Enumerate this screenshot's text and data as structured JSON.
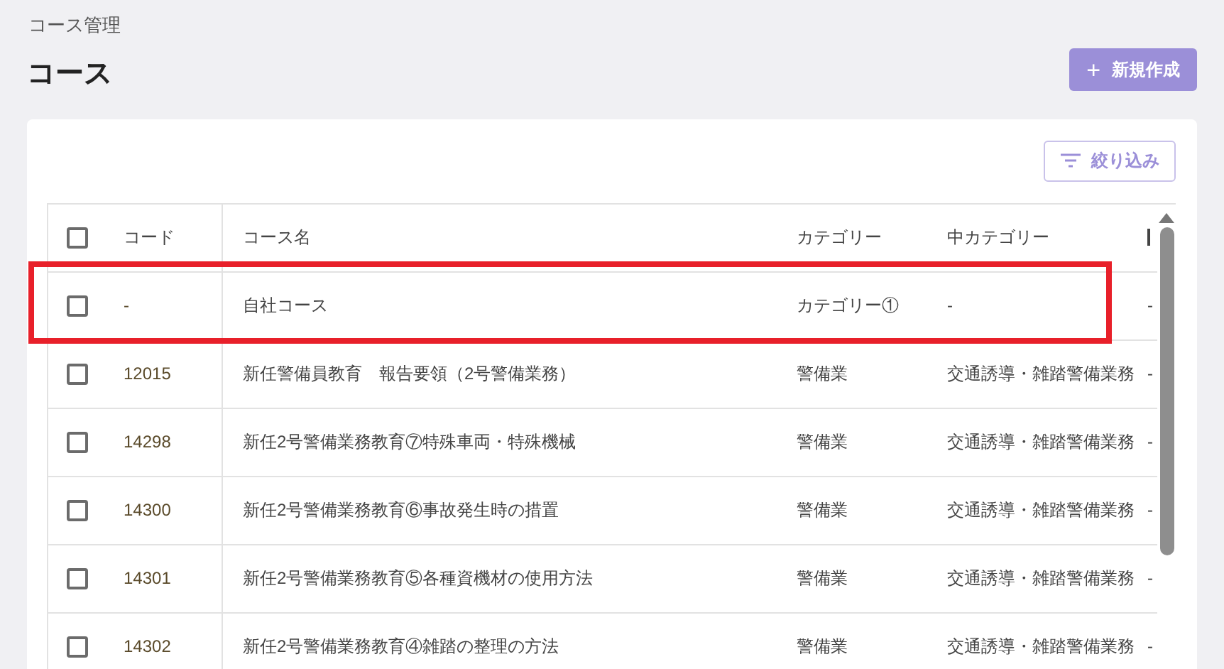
{
  "breadcrumb": "コース管理",
  "title": "コース",
  "create_button": {
    "icon": "+",
    "label": "新規作成"
  },
  "filter_button": {
    "label": "絞り込み"
  },
  "table": {
    "columns": [
      "コード",
      "コース名",
      "カテゴリー",
      "中カテゴリー"
    ],
    "header_checked": false,
    "rows": [
      {
        "checked": false,
        "highlighted": true,
        "code": "-",
        "name": "自社コース",
        "category": "カテゴリー①",
        "sub_category": "-",
        "column_5": "-"
      },
      {
        "checked": false,
        "highlighted": false,
        "code": "12015",
        "name": "新任警備員教育　報告要領（2号警備業務）",
        "category": "警備業",
        "sub_category": "交通誘導・雑踏警備業務",
        "column_5": "-"
      },
      {
        "checked": false,
        "highlighted": false,
        "code": "14298",
        "name": "新任2号警備業務教育⑦特殊車両・特殊機械",
        "category": "警備業",
        "sub_category": "交通誘導・雑踏警備業務",
        "column_5": "-"
      },
      {
        "checked": false,
        "highlighted": false,
        "code": "14300",
        "name": "新任2号警備業務教育⑥事故発生時の措置",
        "category": "警備業",
        "sub_category": "交通誘導・雑踏警備業務",
        "column_5": "-"
      },
      {
        "checked": false,
        "highlighted": false,
        "code": "14301",
        "name": "新任2号警備業務教育⑤各種資機材の使用方法",
        "category": "警備業",
        "sub_category": "交通誘導・雑踏警備業務",
        "column_5": "-"
      },
      {
        "checked": false,
        "highlighted": false,
        "code": "14302",
        "name": "新任2号警備業務教育④雑踏の整理の方法",
        "category": "警備業",
        "sub_category": "交通誘導・雑踏警備業務",
        "column_5": "-"
      }
    ]
  }
}
